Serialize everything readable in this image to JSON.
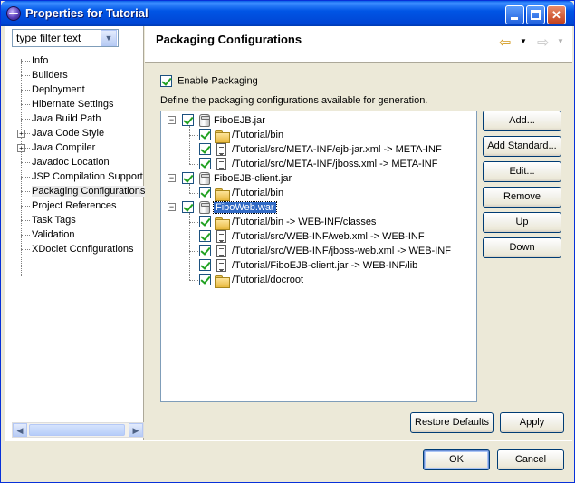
{
  "window": {
    "title": "Properties for Tutorial"
  },
  "filter": {
    "value": "type filter text"
  },
  "nav": {
    "items": [
      {
        "label": "Info",
        "expandable": false
      },
      {
        "label": "Builders",
        "expandable": false
      },
      {
        "label": "Deployment",
        "expandable": false
      },
      {
        "label": "Hibernate Settings",
        "expandable": false
      },
      {
        "label": "Java Build Path",
        "expandable": false
      },
      {
        "label": "Java Code Style",
        "expandable": true
      },
      {
        "label": "Java Compiler",
        "expandable": true
      },
      {
        "label": "Javadoc Location",
        "expandable": false
      },
      {
        "label": "JSP Compilation Support",
        "expandable": false
      },
      {
        "label": "Packaging Configurations",
        "expandable": false,
        "selected": true
      },
      {
        "label": "Project References",
        "expandable": false
      },
      {
        "label": "Task Tags",
        "expandable": false
      },
      {
        "label": "Validation",
        "expandable": false
      },
      {
        "label": "XDoclet Configurations",
        "expandable": false
      }
    ],
    "expand_symbol": "+"
  },
  "header": {
    "title": "Packaging Configurations",
    "back_icon": "back-arrow-icon",
    "forward_icon": "forward-arrow-icon"
  },
  "content": {
    "enable_label": "Enable Packaging",
    "enable_checked": true,
    "define_text": "Define the packaging configurations available for generation.",
    "tree": [
      {
        "label": "FiboEJB.jar",
        "checked": true,
        "children": [
          {
            "label": "/Tutorial/bin",
            "icon": "folder",
            "checked": true
          },
          {
            "label": "/Tutorial/src/META-INF/ejb-jar.xml -> META-INF",
            "icon": "file",
            "checked": true
          },
          {
            "label": "/Tutorial/src/META-INF/jboss.xml -> META-INF",
            "icon": "file",
            "checked": true
          }
        ]
      },
      {
        "label": "FiboEJB-client.jar",
        "checked": true,
        "children": [
          {
            "label": "/Tutorial/bin",
            "icon": "folder",
            "checked": true
          }
        ]
      },
      {
        "label": "FiboWeb.war",
        "checked": true,
        "selected": true,
        "children": [
          {
            "label": "/Tutorial/bin -> WEB-INF/classes",
            "icon": "folder",
            "checked": true
          },
          {
            "label": "/Tutorial/src/WEB-INF/web.xml -> WEB-INF",
            "icon": "file",
            "checked": true
          },
          {
            "label": "/Tutorial/src/WEB-INF/jboss-web.xml -> WEB-INF",
            "icon": "file",
            "checked": true
          },
          {
            "label": "/Tutorial/FiboEJB-client.jar -> WEB-INF/lib",
            "icon": "file",
            "checked": true
          },
          {
            "label": "/Tutorial/docroot",
            "icon": "folder",
            "checked": true
          }
        ]
      }
    ],
    "collapse_symbol": "−",
    "buttons": {
      "add": "Add...",
      "add_standard": "Add Standard...",
      "edit": "Edit...",
      "remove": "Remove",
      "up": "Up",
      "down": "Down"
    },
    "restore_defaults": "Restore Defaults",
    "apply": "Apply"
  },
  "footer": {
    "ok": "OK",
    "cancel": "Cancel"
  }
}
